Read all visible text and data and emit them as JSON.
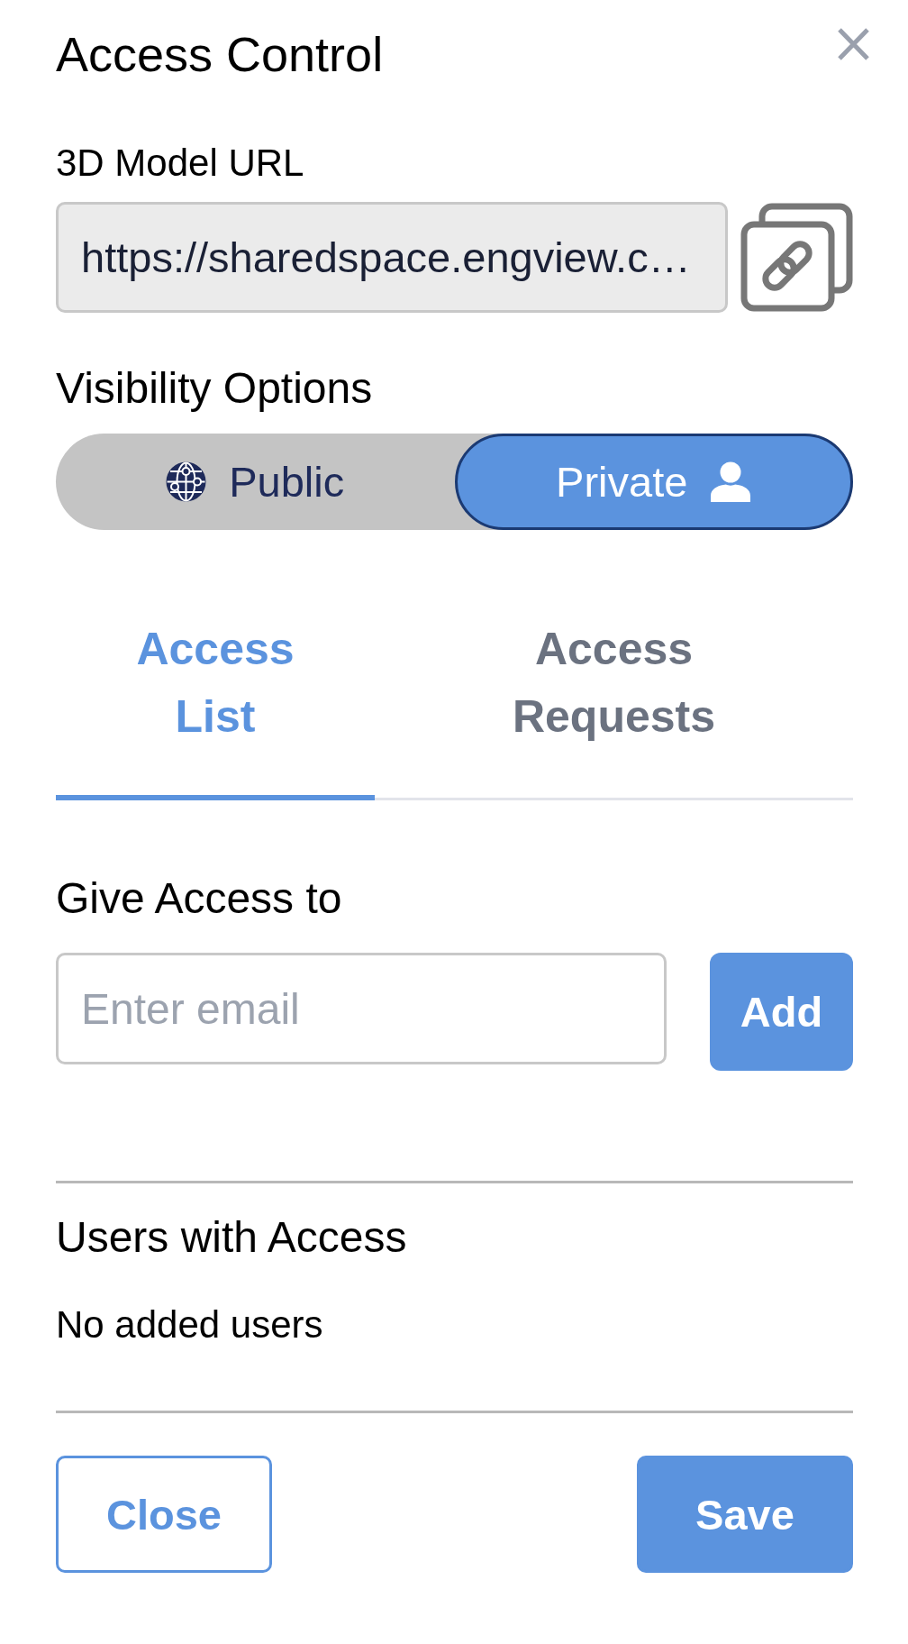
{
  "dialog": {
    "title": "Access Control"
  },
  "url_field": {
    "label": "3D Model URL",
    "value": "https://sharedspace.engview.c…"
  },
  "visibility": {
    "label": "Visibility Options",
    "options": [
      {
        "label": "Public",
        "kind": "public",
        "selected": false
      },
      {
        "label": "Private",
        "kind": "private",
        "selected": true
      }
    ]
  },
  "tabs": [
    {
      "label": "Access List",
      "selected": true
    },
    {
      "label": "Access Requests",
      "selected": false
    }
  ],
  "give_access": {
    "label": "Give Access to",
    "email_field": {
      "placeholder": "Enter email"
    },
    "add_button": "Add"
  },
  "users_with_access": {
    "heading": "Users with Access",
    "empty_message": "No added users"
  },
  "buttons": [
    {
      "label": "Close",
      "kind": "close"
    },
    {
      "label": "Save",
      "kind": "save"
    }
  ]
}
